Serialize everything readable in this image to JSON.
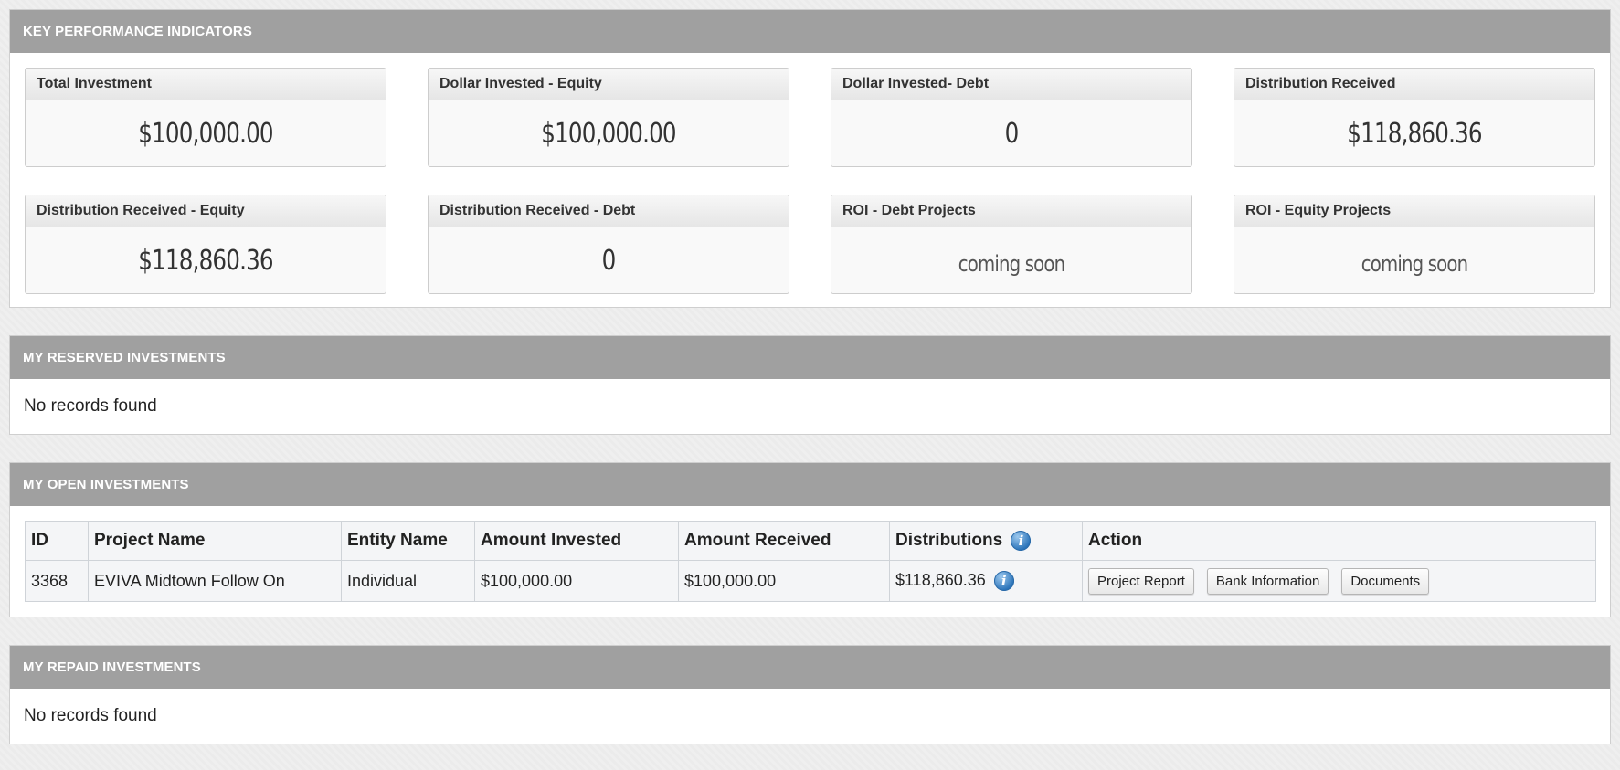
{
  "kpi": {
    "title": "KEY PERFORMANCE INDICATORS",
    "cards": [
      {
        "label": "Total Investment",
        "value": "$100,000.00"
      },
      {
        "label": "Dollar Invested - Equity",
        "value": "$100,000.00"
      },
      {
        "label": "Dollar Invested- Debt",
        "value": "0"
      },
      {
        "label": "Distribution Received",
        "value": "$118,860.36"
      },
      {
        "label": "Distribution Received - Equity",
        "value": "$118,860.36"
      },
      {
        "label": "Distribution Received - Debt",
        "value": "0"
      },
      {
        "label": "ROI - Debt Projects",
        "value": "coming soon"
      },
      {
        "label": "ROI - Equity Projects",
        "value": "coming soon"
      }
    ]
  },
  "reserved": {
    "title": "MY RESERVED INVESTMENTS",
    "empty_text": "No records found"
  },
  "open": {
    "title": "MY OPEN INVESTMENTS",
    "columns": [
      "ID",
      "Project Name",
      "Entity Name",
      "Amount Invested",
      "Amount Received",
      "Distributions",
      "Action"
    ],
    "rows": [
      {
        "id": "3368",
        "project_name": "EVIVA Midtown Follow On",
        "entity_name": "Individual",
        "amount_invested": "$100,000.00",
        "amount_received": "$100,000.00",
        "distributions": "$118,860.36",
        "actions": [
          "Project Report",
          "Bank Information",
          "Documents"
        ]
      }
    ]
  },
  "repaid": {
    "title": "MY REPAID INVESTMENTS",
    "empty_text": "No records found"
  },
  "icons": {
    "info": "info-icon",
    "info_glyph": "i"
  }
}
